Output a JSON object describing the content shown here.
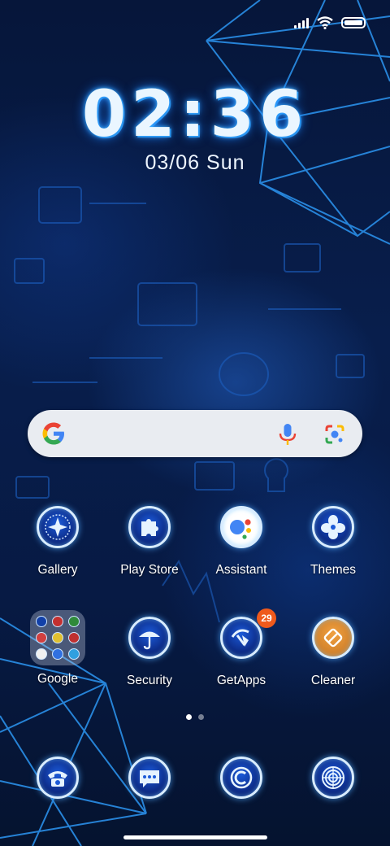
{
  "clock": {
    "time": "02:36",
    "date_num": "03/06",
    "date_day": "Sun"
  },
  "search": {
    "name": "Google search"
  },
  "apps_row1": [
    {
      "label": "Gallery",
      "icon": "gallery-icon"
    },
    {
      "label": "Play Store",
      "icon": "play-store-icon"
    },
    {
      "label": "Assistant",
      "icon": "assistant-icon"
    },
    {
      "label": "Themes",
      "icon": "themes-icon"
    }
  ],
  "apps_row2": [
    {
      "label": "Google",
      "icon": "google-folder-icon"
    },
    {
      "label": "Security",
      "icon": "security-icon"
    },
    {
      "label": "GetApps",
      "icon": "getapps-icon",
      "badge": "29"
    },
    {
      "label": "Cleaner",
      "icon": "cleaner-icon"
    }
  ],
  "dock": [
    {
      "icon": "phone-icon"
    },
    {
      "icon": "messaging-icon"
    },
    {
      "icon": "browser-icon"
    },
    {
      "icon": "camera-icon"
    }
  ],
  "page_indicator": {
    "pages": 2,
    "current": 1
  },
  "colors": {
    "badge": "#ef5a1c",
    "accent": "#3fb4ff",
    "search_bg": "#e9ecf1"
  }
}
